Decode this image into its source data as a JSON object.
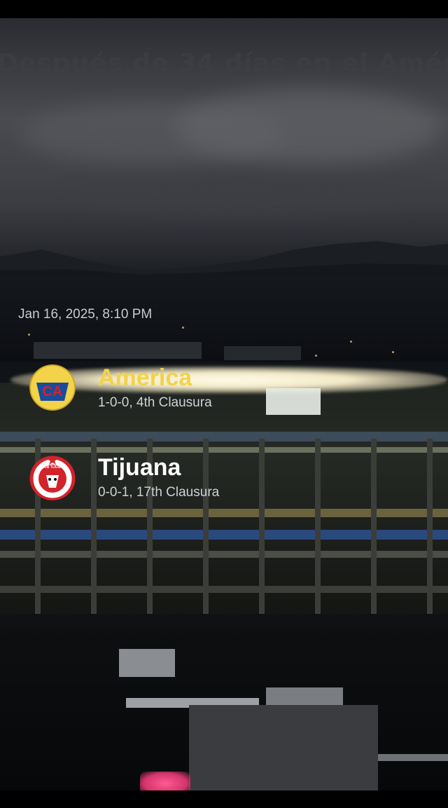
{
  "overlay_caption": "Después de 34 días en el Amér",
  "match": {
    "datetime": "Jan 16, 2025, 8:10 PM"
  },
  "home_team": {
    "name": "America",
    "record": "1-0-0, 4th Clausura",
    "name_color": "#f2d34a",
    "logo_icon": "club-america-crest-icon",
    "logo_text": "CA"
  },
  "away_team": {
    "name": "Tijuana",
    "record": "0-0-1, 17th Clausura",
    "name_color": "#ffffff",
    "logo_icon": "club-tijuana-crest-icon",
    "logo_text": "CLUB TIJUANA"
  },
  "colors": {
    "america_yellow": "#f2d34a",
    "america_blue": "#1a4c9c",
    "tijuana_red": "#d3232a",
    "background": "#000000"
  }
}
